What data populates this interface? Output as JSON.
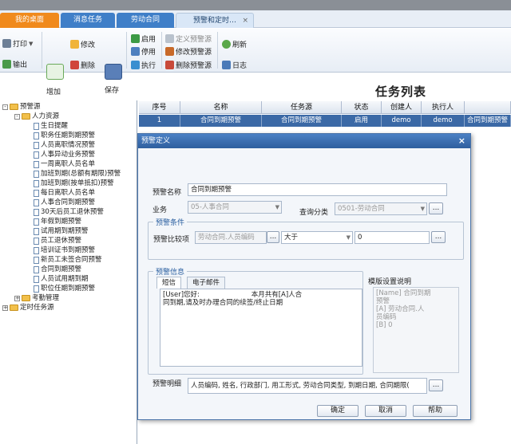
{
  "tabs": [
    {
      "label": "我的桌面"
    },
    {
      "label": "消息任务"
    },
    {
      "label": "劳动合同"
    },
    {
      "label": "预警和定时…",
      "close": "×"
    }
  ],
  "toolbar": {
    "print": "打印",
    "export": "输出",
    "add": "增加",
    "edit": "修改",
    "delete": "删除",
    "save": "保存",
    "enable": "启用",
    "disable": "停用",
    "execute": "执行",
    "define_alert": "定义预警源",
    "modify_alert": "修改预警源",
    "delete_alert": "删除预警源",
    "refresh": "刷新",
    "log": "日志"
  },
  "page_title": "任务列表",
  "tree": [
    {
      "label": "预警源",
      "level": 0,
      "type": "folder",
      "expand": "-"
    },
    {
      "label": "人力资源",
      "level": 1,
      "type": "folder",
      "expand": "-"
    },
    {
      "label": "生日提醒",
      "level": 2,
      "type": "doc"
    },
    {
      "label": "职务任期到期预警",
      "level": 2,
      "type": "doc"
    },
    {
      "label": "人员离职情况预警",
      "level": 2,
      "type": "doc"
    },
    {
      "label": "人事异动业务预警",
      "level": 2,
      "type": "doc"
    },
    {
      "label": "一周离职人员名单",
      "level": 2,
      "type": "doc"
    },
    {
      "label": "加班到期(总额有期限)预警",
      "level": 2,
      "type": "doc"
    },
    {
      "label": "加班到期(按单抵扣)预警",
      "level": 2,
      "type": "doc"
    },
    {
      "label": "每日离职人员名单",
      "level": 2,
      "type": "doc"
    },
    {
      "label": "人事合同到期预警",
      "level": 2,
      "type": "doc"
    },
    {
      "label": "30天后员工退休预警",
      "level": 2,
      "type": "doc"
    },
    {
      "label": "年假到期预警",
      "level": 2,
      "type": "doc"
    },
    {
      "label": "试用期到期预警",
      "level": 2,
      "type": "doc"
    },
    {
      "label": "员工退休预警",
      "level": 2,
      "type": "doc"
    },
    {
      "label": "培训证书到期预警",
      "level": 2,
      "type": "doc"
    },
    {
      "label": "新员工未签合同预警",
      "level": 2,
      "type": "doc"
    },
    {
      "label": "合同到期预警",
      "level": 2,
      "type": "doc"
    },
    {
      "label": "人员试用期到期",
      "level": 2,
      "type": "doc"
    },
    {
      "label": "职位任期到期预警",
      "level": 2,
      "type": "doc"
    },
    {
      "label": "考勤管理",
      "level": 1,
      "type": "folder",
      "expand": "+"
    },
    {
      "label": "定时任务源",
      "level": 0,
      "type": "folder",
      "expand": "+"
    }
  ],
  "grid": {
    "headers": [
      "序号",
      "名称",
      "任务源",
      "状态",
      "创建人",
      "执行人",
      ""
    ],
    "rows": [
      [
        "1",
        "合同到期预警",
        "合同到期预警",
        "启用",
        "demo",
        "demo",
        "合同到期预警"
      ]
    ]
  },
  "dialog": {
    "title": "预警定义",
    "close": "×",
    "name_label": "预警名称",
    "name_value": "合同到期预警",
    "business_label": "业务",
    "business_value": "05-人事合同",
    "query_label": "查询分类",
    "query_value": "0501-劳动合同",
    "browse": "...",
    "cond_group": "预警条件",
    "compare_label": "预警比较项",
    "compare_field": "劳动合同.人员编码",
    "operator": "大于",
    "compare_value": "0",
    "info_group": "预警信息",
    "tab_sms": "短信",
    "tab_email": "电子邮件",
    "message": "[User]您好:                        本月共有[A]人合\n同到期,请及时办理合同的续签/终止日期",
    "template_label": "模版设置说明",
    "template_text": "[Name] 合同到期\n预警\n[A] 劳动合同.人\n员编码\n[B] 0",
    "detail_label": "预警明细",
    "detail_value": "人员编码, 姓名, 行政部门, 用工形式, 劳动合同类型, 到期日期, 合同期限(",
    "ok": "确定",
    "cancel": "取消",
    "help": "帮助"
  }
}
